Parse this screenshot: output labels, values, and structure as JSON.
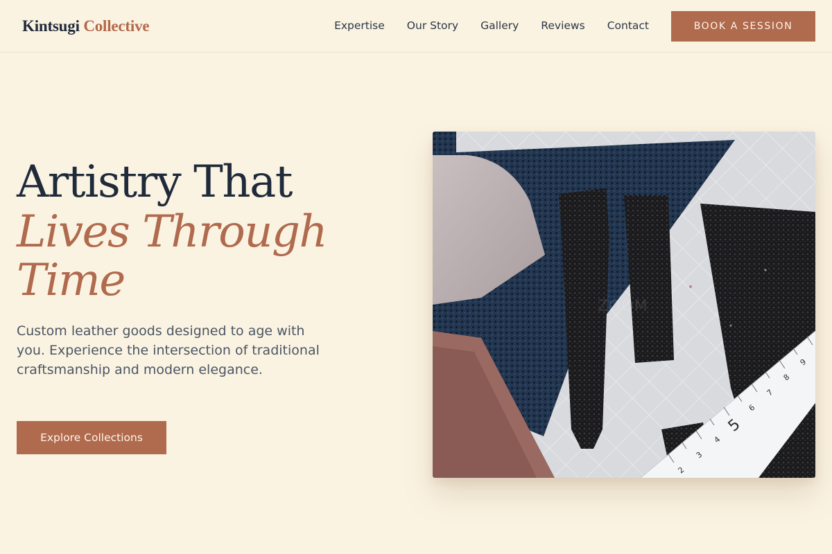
{
  "brand": {
    "name_part1": "Kintsugi",
    "name_part2": "Collective"
  },
  "nav": {
    "items": [
      {
        "label": "Expertise"
      },
      {
        "label": "Our Story"
      },
      {
        "label": "Gallery"
      },
      {
        "label": "Reviews"
      },
      {
        "label": "Contact"
      }
    ],
    "cta_label": "Book a Session"
  },
  "hero": {
    "title_line1": "Artistry That",
    "title_line2": "Lives Through",
    "title_line3": "Time",
    "subtitle": "Custom leather goods designed to age with you. Experience the intersection of traditional craftsmanship and modern elegance.",
    "cta_label": "Explore Collections",
    "image_watermark": "ZOOM"
  },
  "colors": {
    "background": "#fbf3e2",
    "accent": "#b06a4d",
    "text_dark": "#1f2a3a"
  }
}
